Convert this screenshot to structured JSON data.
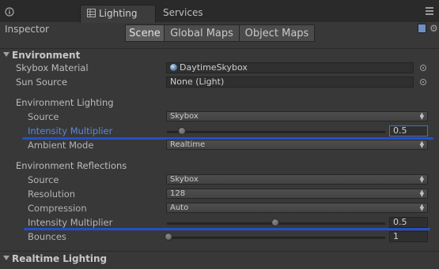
{
  "tabs": [
    {
      "label": "Inspector",
      "icon": "info-icon"
    },
    {
      "label": "Lighting",
      "icon": "lighting-grid-icon"
    },
    {
      "label": "Services",
      "icon": "none"
    }
  ],
  "modes": {
    "scene": "Scene",
    "global_maps": "Global Maps",
    "object_maps": "Object Maps"
  },
  "environment": {
    "title": "Environment",
    "skybox_material": {
      "label": "Skybox Material",
      "value": "DaytimeSkybox"
    },
    "sun_source": {
      "label": "Sun Source",
      "value": "None (Light)"
    },
    "lighting": {
      "title": "Environment Lighting",
      "source": {
        "label": "Source",
        "value": "Skybox"
      },
      "intensity": {
        "label": "Intensity Multiplier",
        "value": "0.5",
        "fraction": 0.25
      },
      "ambient_mode": {
        "label": "Ambient Mode",
        "value": "Realtime"
      }
    },
    "reflections": {
      "title": "Environment Reflections",
      "source": {
        "label": "Source",
        "value": "Skybox"
      },
      "resolution": {
        "label": "Resolution",
        "value": "128"
      },
      "compression": {
        "label": "Compression",
        "value": "Auto"
      },
      "intensity": {
        "label": "Intensity Multiplier",
        "value": "0.5",
        "fraction": 0.5
      },
      "bounces": {
        "label": "Bounces",
        "value": "1",
        "fraction": 0.0
      }
    }
  },
  "realtime": {
    "title": "Realtime Lighting"
  },
  "colors": {
    "highlight_label": "#5b87dc",
    "annotation": "#2550c8",
    "focus_border": "#4a6fbf"
  }
}
